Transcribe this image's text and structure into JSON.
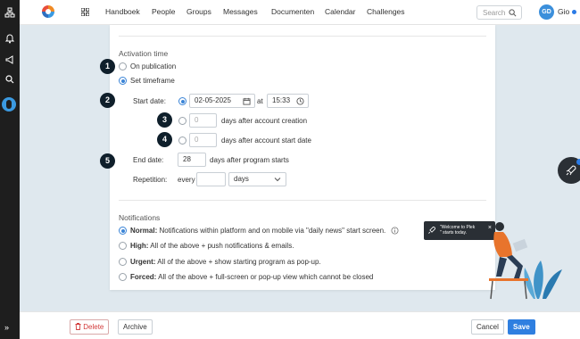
{
  "nav": {
    "items": [
      "Handboek",
      "People",
      "Groups",
      "Messages",
      "Documenten",
      "Calendar",
      "Challenges"
    ],
    "search_placeholder": "Search",
    "user_initials": "GD",
    "user_name": "Gio"
  },
  "activation": {
    "title": "Activation time",
    "on_publication": "On publication",
    "set_timeframe": "Set timeframe",
    "selected": "Set timeframe",
    "start_date_label": "Start date:",
    "start_date": "02-05-2025",
    "at": "at",
    "start_time": "15:33",
    "days_creation_placeholder": "0",
    "days_creation_label": "days after account creation",
    "days_start_placeholder": "0",
    "days_start_label": "days after account start date",
    "end_date_label": "End date:",
    "end_days": "28",
    "end_days_label": "days after program starts",
    "repetition_label": "Repetition:",
    "every": "every",
    "repetition_unit": "days"
  },
  "notifications": {
    "title": "Notifications",
    "options": [
      {
        "name": "Normal:",
        "desc": "Notifications within platform and on mobile via \"daily news\" start screen.",
        "selected": true
      },
      {
        "name": "High:",
        "desc": "All of the above + push notifications & emails.",
        "selected": false
      },
      {
        "name": "Urgent:",
        "desc": "All of the above + show starting program as pop-up.",
        "selected": false
      },
      {
        "name": "Forced:",
        "desc": "All of the above + full-screen or pop-up view which cannot be closed",
        "selected": false
      }
    ]
  },
  "badges": [
    "1",
    "2",
    "3",
    "4",
    "5"
  ],
  "toast": {
    "line1": "\"Welcome to Plek",
    "line2": "\" starts today.",
    "close": "×"
  },
  "footer": {
    "delete": "Delete",
    "archive": "Archive",
    "cancel": "Cancel",
    "save": "Save"
  },
  "icons": {
    "rail": [
      "network-icon",
      "bell-icon",
      "megaphone-icon",
      "search-icon",
      "profile-icon",
      "expand-icon"
    ],
    "accent": "#2f7fe0",
    "danger": "#d23b3b"
  }
}
